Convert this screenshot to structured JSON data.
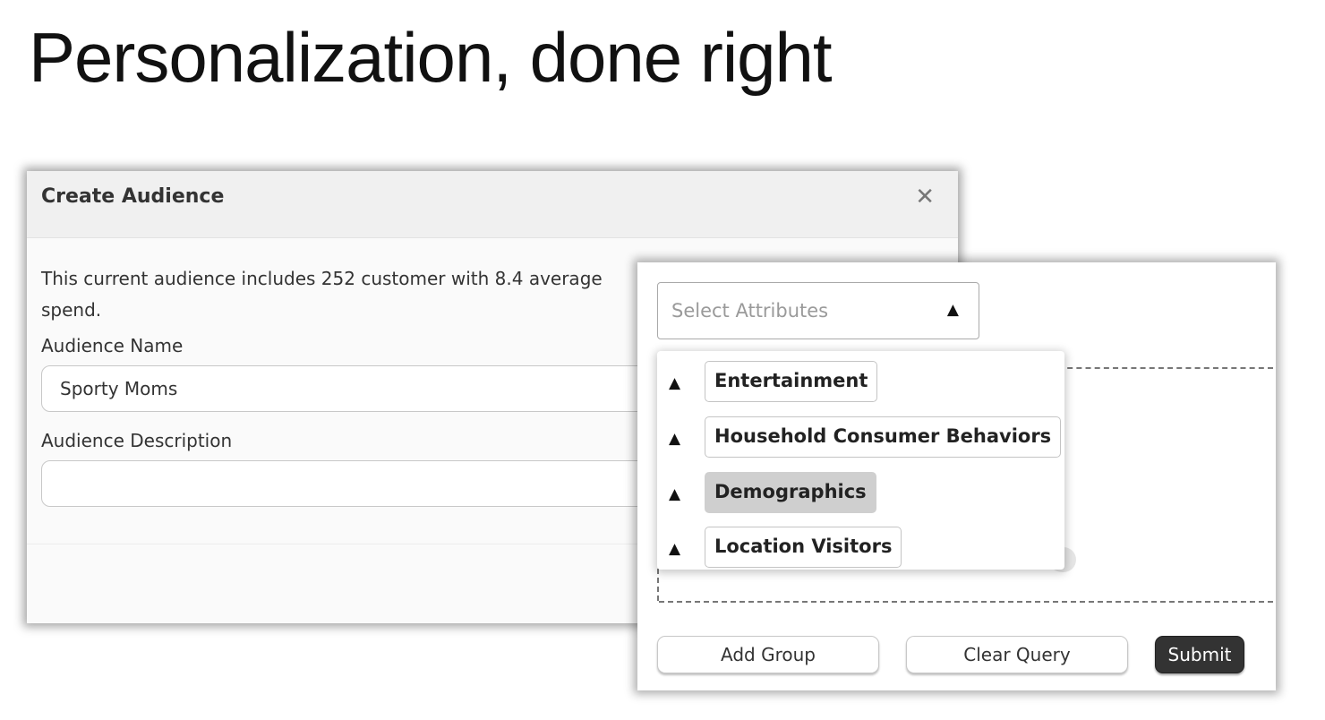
{
  "slide": {
    "title": "Personalization, done right"
  },
  "modal": {
    "title": "Create Audience",
    "close_icon": "close-icon",
    "summary": "This current audience includes 252 customer with 8.4 average spend.",
    "name_label": "Audience Name",
    "name_value": "Sporty Moms",
    "description_label": "Audience Description",
    "description_value": ""
  },
  "query": {
    "select_placeholder": "Select Attributes",
    "caret_icon": "caret-up-icon",
    "attributes": [
      {
        "label": "Entertainment",
        "selected": false
      },
      {
        "label": "Household Consumer Behaviors",
        "selected": false
      },
      {
        "label": "Demographics",
        "selected": true
      },
      {
        "label": "Location Visitors",
        "selected": false
      }
    ],
    "buttons": {
      "add_group": "Add Group",
      "clear_query": "Clear Query",
      "submit": "Submit"
    }
  },
  "colors": {
    "submit_bg": "#333333",
    "selected_chip_bg": "#cfcfcf",
    "header_bg": "#f0f0f0"
  }
}
